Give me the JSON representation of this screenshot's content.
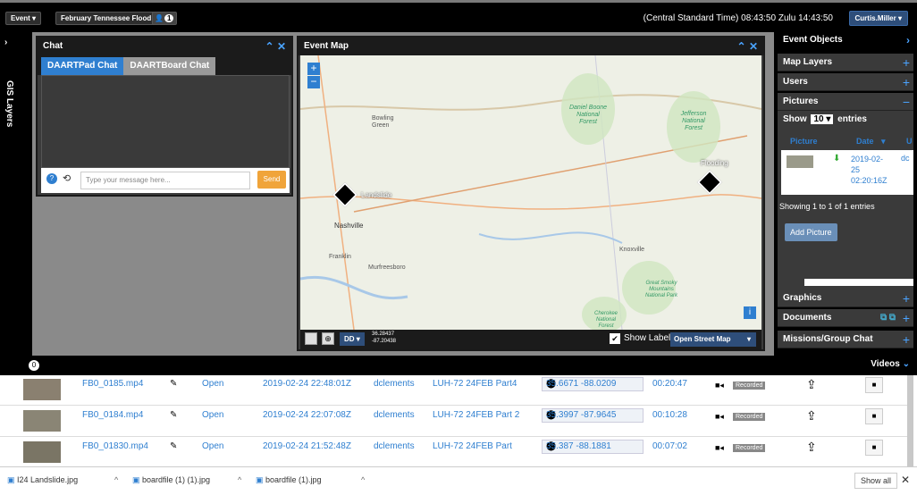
{
  "topbar": {
    "event_menu": "Event",
    "event_name": "February Tennessee Flood",
    "user_count": "1",
    "time_info": "(Central Standard Time) 08:43:50  Zulu 14:43:50",
    "user_menu": "Curtis.Miller"
  },
  "gis": {
    "label": "GIS Layers"
  },
  "chat": {
    "title": "Chat",
    "tabs": [
      "DAARTPad Chat",
      "DAARTBoard Chat"
    ],
    "input_placeholder": "Type your message here...",
    "send": "Send"
  },
  "map": {
    "title": "Event Map",
    "cities": [
      "Bowling Green",
      "Daniel Boone National Forest",
      "Jefferson National Forest",
      "Nashville",
      "Franklin",
      "Murfreesboro",
      "Knoxville",
      "Great Smoky Mountains National Park",
      "Cherokee National Forest"
    ],
    "marker_labels": [
      "Landslide",
      "Flooding"
    ],
    "coord_format": "DD",
    "coord_lat": "36.28437",
    "coord_lon": "-87.20438",
    "show_labels": "Show Labels",
    "basemap": "Open Street Map"
  },
  "right": {
    "title": "Event Objects",
    "sections": [
      "Map Layers",
      "Users",
      "Pictures",
      "Graphics",
      "Documents",
      "Missions/Group Chat"
    ],
    "show": "Show",
    "entries_count": "10",
    "entries": "entries",
    "col_picture": "Picture",
    "col_date": "Date",
    "col_user": "U",
    "pic_date": "2019-02-25 02:20:16Z",
    "pic_user": "dc",
    "showing": "Showing 1 to 1 of 1 entries",
    "add_picture": "Add Picture"
  },
  "videos": {
    "count": "0",
    "title": "Videos",
    "open_label": "Open",
    "recorded_label": "Recorded",
    "rows": [
      {
        "file": "FB0_0185.mp4",
        "date": "2019-02-24 22:48:01Z",
        "user": "dclements",
        "name": "LUH-72 24FEB Part4",
        "coord": "35.6671 -88.0209",
        "duration": "00:20:47"
      },
      {
        "file": "FB0_0184.mp4",
        "date": "2019-02-24 22:07:08Z",
        "user": "dclements",
        "name": "LUH-72 24FEB Part 2",
        "coord": "35.3997 -87.9645",
        "duration": "00:10:28"
      },
      {
        "file": "FB0_01830.mp4",
        "date": "2019-02-24 21:52:48Z",
        "user": "dclements",
        "name": "LUH-72 24FEB Part",
        "coord": "35.387 -88.1881",
        "duration": "00:07:02"
      }
    ]
  },
  "downloads": {
    "files": [
      "I24 Landslide.jpg",
      "boardfile (1) (1).jpg",
      "boardfile (1).jpg"
    ],
    "show_all": "Show all"
  }
}
